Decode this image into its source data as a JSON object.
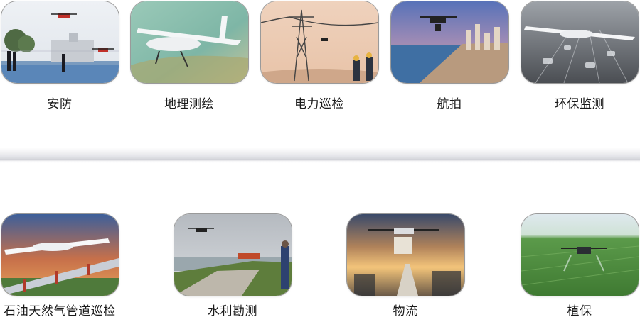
{
  "row1": [
    {
      "label": "安防",
      "icon": "security-patrol-drone-image"
    },
    {
      "label": "地理测绘",
      "icon": "fixed-wing-mapping-drone-image"
    },
    {
      "label": "电力巡检",
      "icon": "power-line-inspection-image"
    },
    {
      "label": "航拍",
      "icon": "aerial-photography-city-image"
    },
    {
      "label": "环保监测",
      "icon": "environmental-monitoring-image"
    }
  ],
  "row2": [
    {
      "label": "石油天然气管道巡检",
      "icon": "pipeline-inspection-image"
    },
    {
      "label": "水利勘测",
      "icon": "water-conservancy-survey-image"
    },
    {
      "label": "物流",
      "icon": "logistics-delivery-drone-image"
    },
    {
      "label": "植保",
      "icon": "crop-protection-spraying-image"
    }
  ]
}
